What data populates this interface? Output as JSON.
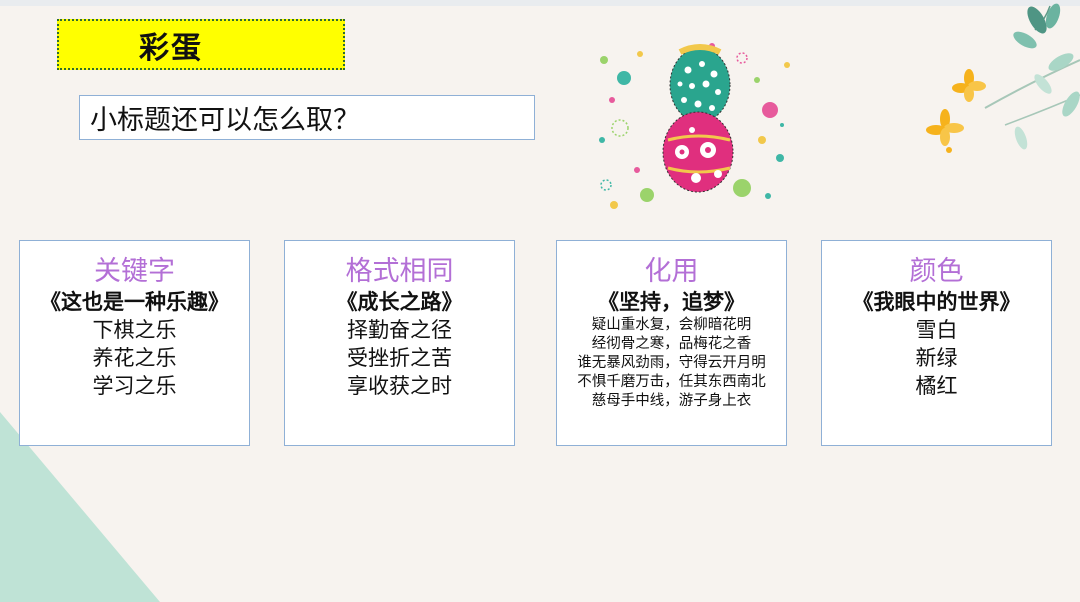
{
  "slide": {
    "title": "彩蛋",
    "subtitle": "小标题还可以怎么取？"
  },
  "cards": [
    {
      "heading": "关键字",
      "subtitle": "《这也是一种乐趣》",
      "lines": [
        "下棋之乐",
        "养花之乐",
        "学习之乐"
      ]
    },
    {
      "heading": "格式相同",
      "subtitle": "《成长之路》",
      "lines": [
        "择勤奋之径",
        "受挫折之苦",
        "享收获之时"
      ]
    },
    {
      "heading": "化用",
      "subtitle": "《坚持，追梦》",
      "lines": [
        "疑山重水复，会柳暗花明",
        "经彻骨之寒，品梅花之香",
        "谁无暴风劲雨，守得云开月明",
        "不惧千磨万击，任其东西南北",
        "慈母手中线，游子身上衣"
      ]
    },
    {
      "heading": "颜色",
      "subtitle": "《我眼中的世界》",
      "lines": [
        "雪白",
        "新绿",
        "橘红"
      ]
    }
  ],
  "colors": {
    "background": "#f7f3ef",
    "title_highlight": "#ffff00",
    "heading_purple": "#b36fd6",
    "card_border": "#8fb0d6",
    "corner_mint": "#bfe3d6"
  },
  "decorations": {
    "eggs_icon": "easter-eggs-icon",
    "flower_icon": "flower-branch-icon"
  }
}
